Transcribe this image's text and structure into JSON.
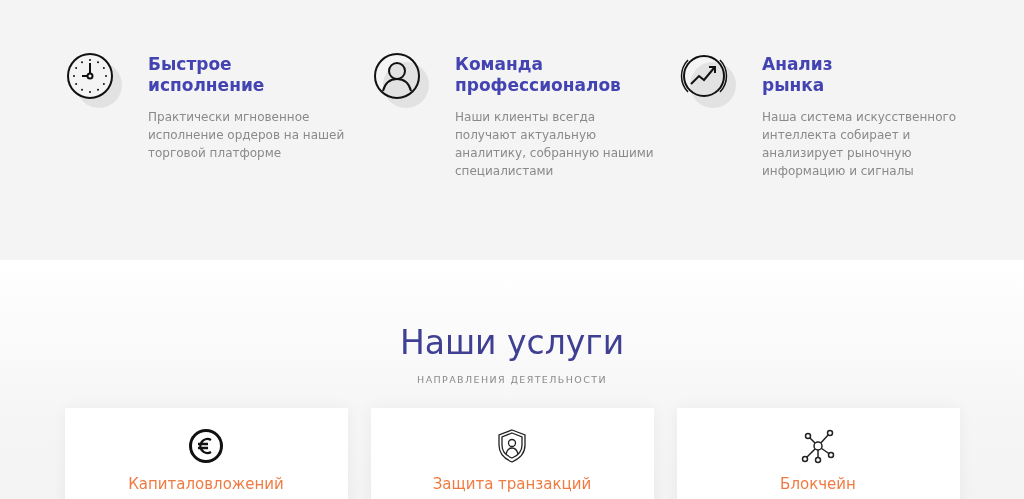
{
  "features": [
    {
      "title_lines": [
        "Быстрое",
        "исполнение"
      ],
      "description": "Практически мгновенное исполнение ордеров на нашей торговой платформе"
    },
    {
      "title_lines": [
        "Команда",
        "профессионалов"
      ],
      "description": "Наши клиенты всегда получают актуальную аналитику, собранную нашими специалистами"
    },
    {
      "title_lines": [
        "Анализ",
        "рынка"
      ],
      "description": "Наша система искусственного интеллекта собирает и анализирует рыночную информацию и сигналы"
    }
  ],
  "services": {
    "title": "Наши услуги",
    "subtitle": "НАПРАВЛЕНИЯ ДЕЯТЕЛЬНОСТИ",
    "cards": [
      {
        "title": "Капиталовложений"
      },
      {
        "title": "Защита транзакций"
      },
      {
        "title": "Блокчейн"
      }
    ]
  }
}
